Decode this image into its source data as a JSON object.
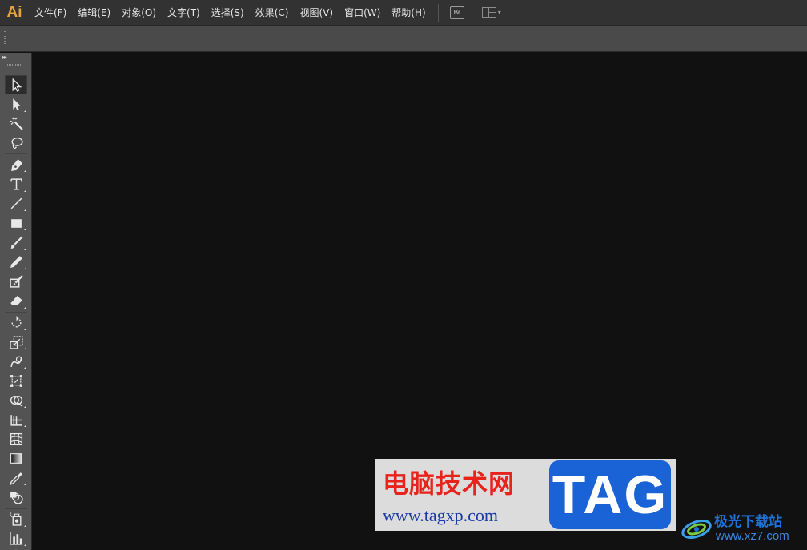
{
  "app": {
    "logo": "Ai"
  },
  "menu": [
    {
      "id": "file",
      "label": "文件(F)"
    },
    {
      "id": "edit",
      "label": "编辑(E)"
    },
    {
      "id": "object",
      "label": "对象(O)"
    },
    {
      "id": "type",
      "label": "文字(T)"
    },
    {
      "id": "select",
      "label": "选择(S)"
    },
    {
      "id": "effect",
      "label": "效果(C)"
    },
    {
      "id": "view",
      "label": "视图(V)"
    },
    {
      "id": "window",
      "label": "窗口(W)"
    },
    {
      "id": "help",
      "label": "帮助(H)"
    }
  ],
  "bridge_button": {
    "label": "Br"
  },
  "workspace_switcher": {
    "icon": "layout-grid-icon",
    "arrow": "▾"
  },
  "tools_panel": {
    "collapse_glyph": "▸▸",
    "tools": [
      {
        "icon": "selection-arrow-icon",
        "active": true
      },
      {
        "icon": "direct-selection-icon"
      },
      {
        "icon": "magic-wand-icon"
      },
      {
        "icon": "lasso-icon"
      },
      {
        "icon": "pen-icon"
      },
      {
        "icon": "type-icon"
      },
      {
        "icon": "line-segment-icon"
      },
      {
        "icon": "rectangle-icon"
      },
      {
        "icon": "paintbrush-icon"
      },
      {
        "icon": "pencil-icon"
      },
      {
        "icon": "blob-brush-icon"
      },
      {
        "icon": "eraser-icon"
      },
      {
        "icon": "rotate-icon"
      },
      {
        "icon": "scale-icon"
      },
      {
        "icon": "warp-icon"
      },
      {
        "icon": "free-transform-icon"
      },
      {
        "icon": "shape-builder-icon"
      },
      {
        "icon": "perspective-grid-icon"
      },
      {
        "icon": "mesh-icon"
      },
      {
        "icon": "gradient-icon"
      },
      {
        "icon": "eyedropper-icon"
      },
      {
        "icon": "blend-icon"
      },
      {
        "icon": "symbol-sprayer-icon"
      },
      {
        "icon": "column-graph-icon"
      },
      {
        "icon": "artboard-icon"
      }
    ]
  },
  "watermarks": {
    "tag_site": {
      "cn": "电脑技术网",
      "url": "www.tagxp.com",
      "badge": "TAG"
    },
    "xz_site": {
      "name": "极光下载站",
      "url": "www.xz7.com"
    }
  },
  "colors": {
    "accent": "#e8a33a",
    "canvas": "#111111",
    "panel": "#535353",
    "menubar": "#323232"
  }
}
